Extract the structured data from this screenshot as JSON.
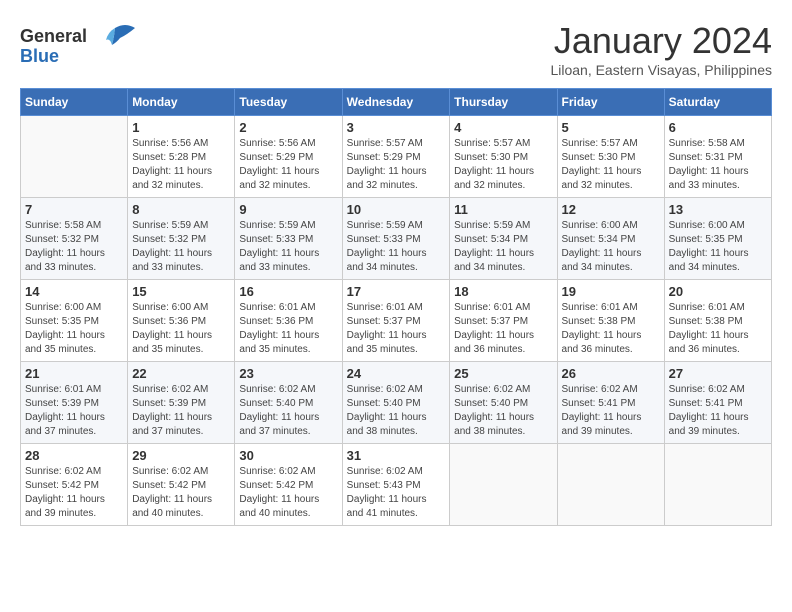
{
  "header": {
    "logo_line1": "General",
    "logo_line2": "Blue",
    "month_title": "January 2024",
    "location": "Liloan, Eastern Visayas, Philippines"
  },
  "days_of_week": [
    "Sunday",
    "Monday",
    "Tuesday",
    "Wednesday",
    "Thursday",
    "Friday",
    "Saturday"
  ],
  "weeks": [
    [
      {
        "day": "",
        "info": ""
      },
      {
        "day": "1",
        "info": "Sunrise: 5:56 AM\nSunset: 5:28 PM\nDaylight: 11 hours\nand 32 minutes."
      },
      {
        "day": "2",
        "info": "Sunrise: 5:56 AM\nSunset: 5:29 PM\nDaylight: 11 hours\nand 32 minutes."
      },
      {
        "day": "3",
        "info": "Sunrise: 5:57 AM\nSunset: 5:29 PM\nDaylight: 11 hours\nand 32 minutes."
      },
      {
        "day": "4",
        "info": "Sunrise: 5:57 AM\nSunset: 5:30 PM\nDaylight: 11 hours\nand 32 minutes."
      },
      {
        "day": "5",
        "info": "Sunrise: 5:57 AM\nSunset: 5:30 PM\nDaylight: 11 hours\nand 32 minutes."
      },
      {
        "day": "6",
        "info": "Sunrise: 5:58 AM\nSunset: 5:31 PM\nDaylight: 11 hours\nand 33 minutes."
      }
    ],
    [
      {
        "day": "7",
        "info": "Sunrise: 5:58 AM\nSunset: 5:32 PM\nDaylight: 11 hours\nand 33 minutes."
      },
      {
        "day": "8",
        "info": "Sunrise: 5:59 AM\nSunset: 5:32 PM\nDaylight: 11 hours\nand 33 minutes."
      },
      {
        "day": "9",
        "info": "Sunrise: 5:59 AM\nSunset: 5:33 PM\nDaylight: 11 hours\nand 33 minutes."
      },
      {
        "day": "10",
        "info": "Sunrise: 5:59 AM\nSunset: 5:33 PM\nDaylight: 11 hours\nand 34 minutes."
      },
      {
        "day": "11",
        "info": "Sunrise: 5:59 AM\nSunset: 5:34 PM\nDaylight: 11 hours\nand 34 minutes."
      },
      {
        "day": "12",
        "info": "Sunrise: 6:00 AM\nSunset: 5:34 PM\nDaylight: 11 hours\nand 34 minutes."
      },
      {
        "day": "13",
        "info": "Sunrise: 6:00 AM\nSunset: 5:35 PM\nDaylight: 11 hours\nand 34 minutes."
      }
    ],
    [
      {
        "day": "14",
        "info": "Sunrise: 6:00 AM\nSunset: 5:35 PM\nDaylight: 11 hours\nand 35 minutes."
      },
      {
        "day": "15",
        "info": "Sunrise: 6:00 AM\nSunset: 5:36 PM\nDaylight: 11 hours\nand 35 minutes."
      },
      {
        "day": "16",
        "info": "Sunrise: 6:01 AM\nSunset: 5:36 PM\nDaylight: 11 hours\nand 35 minutes."
      },
      {
        "day": "17",
        "info": "Sunrise: 6:01 AM\nSunset: 5:37 PM\nDaylight: 11 hours\nand 35 minutes."
      },
      {
        "day": "18",
        "info": "Sunrise: 6:01 AM\nSunset: 5:37 PM\nDaylight: 11 hours\nand 36 minutes."
      },
      {
        "day": "19",
        "info": "Sunrise: 6:01 AM\nSunset: 5:38 PM\nDaylight: 11 hours\nand 36 minutes."
      },
      {
        "day": "20",
        "info": "Sunrise: 6:01 AM\nSunset: 5:38 PM\nDaylight: 11 hours\nand 36 minutes."
      }
    ],
    [
      {
        "day": "21",
        "info": "Sunrise: 6:01 AM\nSunset: 5:39 PM\nDaylight: 11 hours\nand 37 minutes."
      },
      {
        "day": "22",
        "info": "Sunrise: 6:02 AM\nSunset: 5:39 PM\nDaylight: 11 hours\nand 37 minutes."
      },
      {
        "day": "23",
        "info": "Sunrise: 6:02 AM\nSunset: 5:40 PM\nDaylight: 11 hours\nand 37 minutes."
      },
      {
        "day": "24",
        "info": "Sunrise: 6:02 AM\nSunset: 5:40 PM\nDaylight: 11 hours\nand 38 minutes."
      },
      {
        "day": "25",
        "info": "Sunrise: 6:02 AM\nSunset: 5:40 PM\nDaylight: 11 hours\nand 38 minutes."
      },
      {
        "day": "26",
        "info": "Sunrise: 6:02 AM\nSunset: 5:41 PM\nDaylight: 11 hours\nand 39 minutes."
      },
      {
        "day": "27",
        "info": "Sunrise: 6:02 AM\nSunset: 5:41 PM\nDaylight: 11 hours\nand 39 minutes."
      }
    ],
    [
      {
        "day": "28",
        "info": "Sunrise: 6:02 AM\nSunset: 5:42 PM\nDaylight: 11 hours\nand 39 minutes."
      },
      {
        "day": "29",
        "info": "Sunrise: 6:02 AM\nSunset: 5:42 PM\nDaylight: 11 hours\nand 40 minutes."
      },
      {
        "day": "30",
        "info": "Sunrise: 6:02 AM\nSunset: 5:42 PM\nDaylight: 11 hours\nand 40 minutes."
      },
      {
        "day": "31",
        "info": "Sunrise: 6:02 AM\nSunset: 5:43 PM\nDaylight: 11 hours\nand 41 minutes."
      },
      {
        "day": "",
        "info": ""
      },
      {
        "day": "",
        "info": ""
      },
      {
        "day": "",
        "info": ""
      }
    ]
  ]
}
